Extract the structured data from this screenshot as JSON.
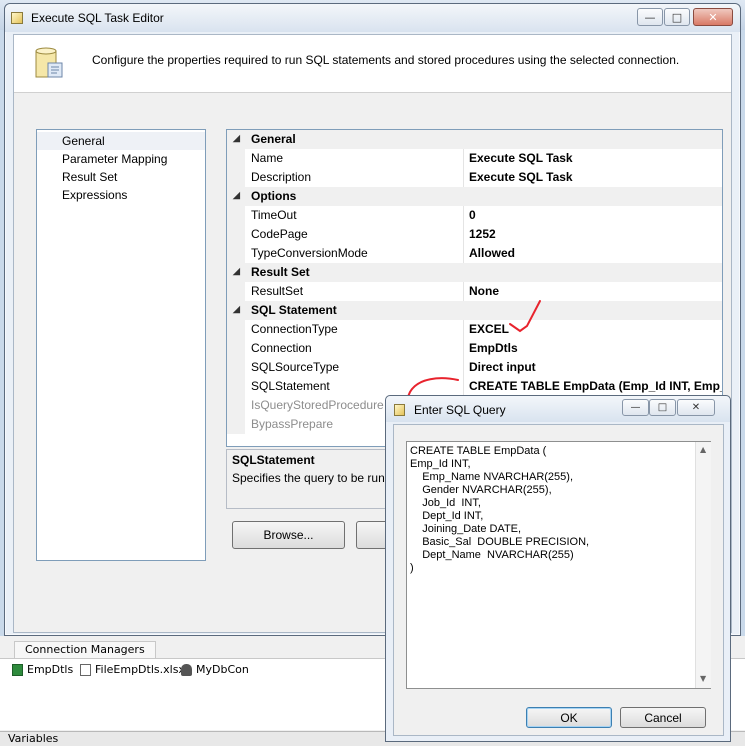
{
  "window": {
    "title": "Execute SQL Task Editor",
    "header_text": "Configure the properties required to run SQL statements and stored procedures using the selected connection."
  },
  "nav": {
    "items": [
      "General",
      "Parameter Mapping",
      "Result Set",
      "Expressions"
    ],
    "selected": "General"
  },
  "grid": {
    "general": {
      "label": "General",
      "name": "Name",
      "name_val": "Execute SQL Task",
      "desc": "Description",
      "desc_val": "Execute SQL Task"
    },
    "options": {
      "label": "Options",
      "timeout": "TimeOut",
      "timeout_val": "0",
      "codepage": "CodePage",
      "codepage_val": "1252",
      "tcm": "TypeConversionMode",
      "tcm_val": "Allowed"
    },
    "resultset": {
      "label": "Result Set",
      "rs": "ResultSet",
      "rs_val": "None"
    },
    "sql": {
      "label": "SQL Statement",
      "ctype": "ConnectionType",
      "ctype_val": "EXCEL",
      "conn": "Connection",
      "conn_val": "EmpDtls",
      "src": "SQLSourceType",
      "src_val": "Direct input",
      "stmt": "SQLStatement",
      "stmt_val": "CREATE TABLE EmpData (Emp_Id INT,     Emp_N",
      "isqsp": "IsQueryStoredProcedure",
      "bypass": "BypassPrepare"
    }
  },
  "description_panel": {
    "title": "SQLStatement",
    "text": "Specifies the query to be run by the task."
  },
  "buttons": {
    "browse": "Browse..."
  },
  "connection_managers": {
    "tab": "Connection Managers",
    "items": [
      "EmpDtls",
      "FileEmpDtls.xlsx",
      "MyDbCon"
    ]
  },
  "variables_tab": "Variables",
  "query_dialog": {
    "title": "Enter SQL Query",
    "sql": "CREATE TABLE EmpData (\nEmp_Id INT,\n    Emp_Name NVARCHAR(255),\n    Gender NVARCHAR(255),\n    Job_Id  INT,\n    Dept_Id INT,\n    Joining_Date DATE,\n    Basic_Sal  DOUBLE PRECISION,\n    Dept_Name  NVARCHAR(255)\n)",
    "ok": "OK",
    "cancel": "Cancel"
  },
  "colors": {
    "annotation": "#e8232d",
    "accent": "#3c7fb1"
  },
  "icons": [
    "task-editor-icon",
    "minimize-icon",
    "maximize-icon",
    "close-icon",
    "excel-connection-icon",
    "file-connection-icon",
    "db-connection-icon"
  ]
}
